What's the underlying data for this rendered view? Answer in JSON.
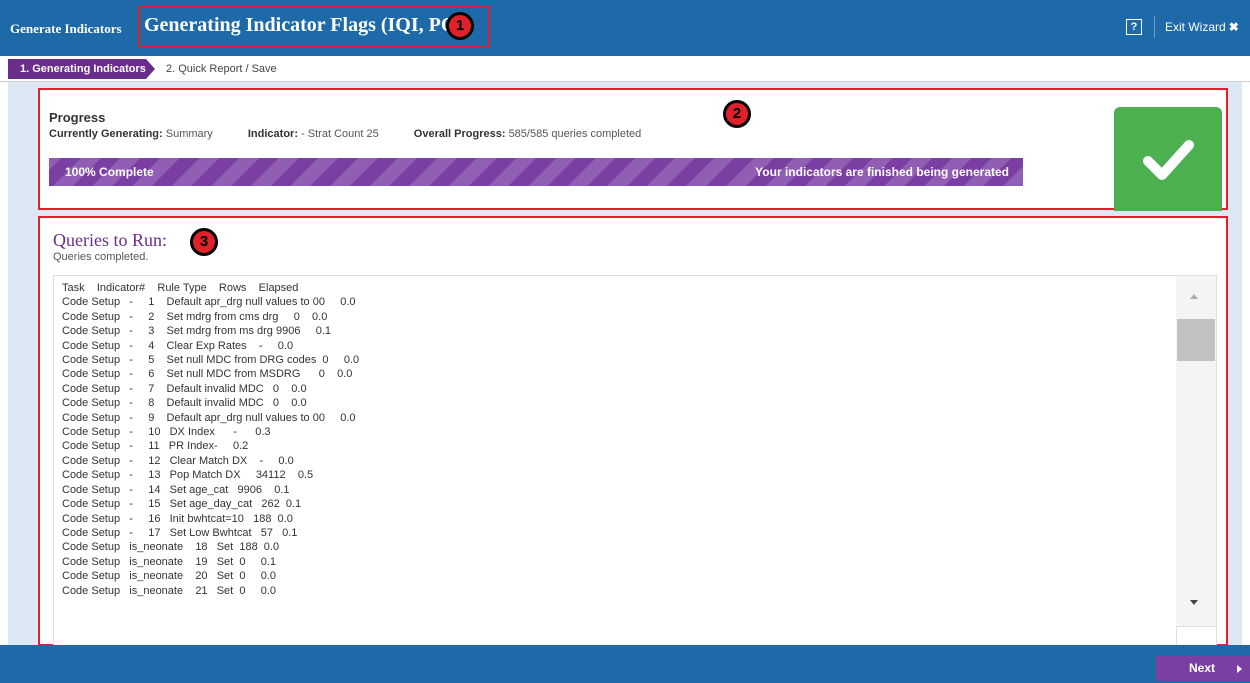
{
  "header": {
    "brand": "Generate Indicators",
    "title": "Generating Indicator Flags (IQI, PQI)",
    "help_label": "?",
    "exit_label": "Exit Wizard",
    "exit_icon": "✖"
  },
  "markers": [
    "1",
    "2",
    "3"
  ],
  "steps": [
    {
      "label": "1. Generating Indicators",
      "active": true
    },
    {
      "label": "2. Quick Report / Save",
      "active": false
    }
  ],
  "progress": {
    "title": "Progress",
    "currently_generating_label": "Currently Generating:",
    "currently_generating_value": "Summary",
    "indicator_label": "Indicator:",
    "indicator_value": "- Strat Count 25",
    "overall_label": "Overall Progress:",
    "overall_value": "585/585 queries completed",
    "percent": 100,
    "bar_left_text": "100% Complete",
    "bar_right_text": "Your indicators are finished being generated",
    "status_icon": "check-icon"
  },
  "queries": {
    "title": "Queries to Run:",
    "subtitle": "Queries completed.",
    "lines": [
      "Task    Indicator#    Rule Type    Rows    Elapsed",
      "Code Setup   -     1    Default apr_drg null values to 00     0.0",
      "Code Setup   -     2    Set mdrg from cms drg     0    0.0",
      "Code Setup   -     3    Set mdrg from ms drg 9906     0.1",
      "Code Setup   -     4    Clear Exp Rates    -     0.0",
      "Code Setup   -     5    Set null MDC from DRG codes  0     0.0",
      "Code Setup   -     6    Set null MDC from MSDRG      0    0.0",
      "Code Setup   -     7    Default invalid MDC   0    0.0",
      "Code Setup   -     8    Default invalid MDC   0    0.0",
      "Code Setup   -     9    Default apr_drg null values to 00     0.0",
      "Code Setup   -     10   DX Index      -      0.3",
      "Code Setup   -     11   PR Index-     0.2",
      "Code Setup   -     12   Clear Match DX    -     0.0",
      "Code Setup   -     13   Pop Match DX     34112    0.5",
      "Code Setup   -     14   Set age_cat   9906    0.1",
      "Code Setup   -     15   Set age_day_cat   262  0.1",
      "Code Setup   -     16   Init bwhtcat=10   188  0.0",
      "Code Setup   -     17   Set Low Bwhtcat   57   0.1",
      "Code Setup   is_neonate    18   Set  188  0.0",
      "Code Setup   is_neonate    19   Set  0     0.1",
      "Code Setup   is_neonate    20   Set  0     0.0",
      "Code Setup   is_neonate    21   Set  0     0.0"
    ]
  },
  "footer": {
    "next_label": "Next"
  },
  "colors": {
    "header_blue": "#1e6aa8",
    "purple": "#6b2d8c",
    "bar_purple": "#7b3fa4",
    "success_green": "#4caf50",
    "highlight_red": "#e0212b",
    "panel_bg": "#dce9f4"
  }
}
